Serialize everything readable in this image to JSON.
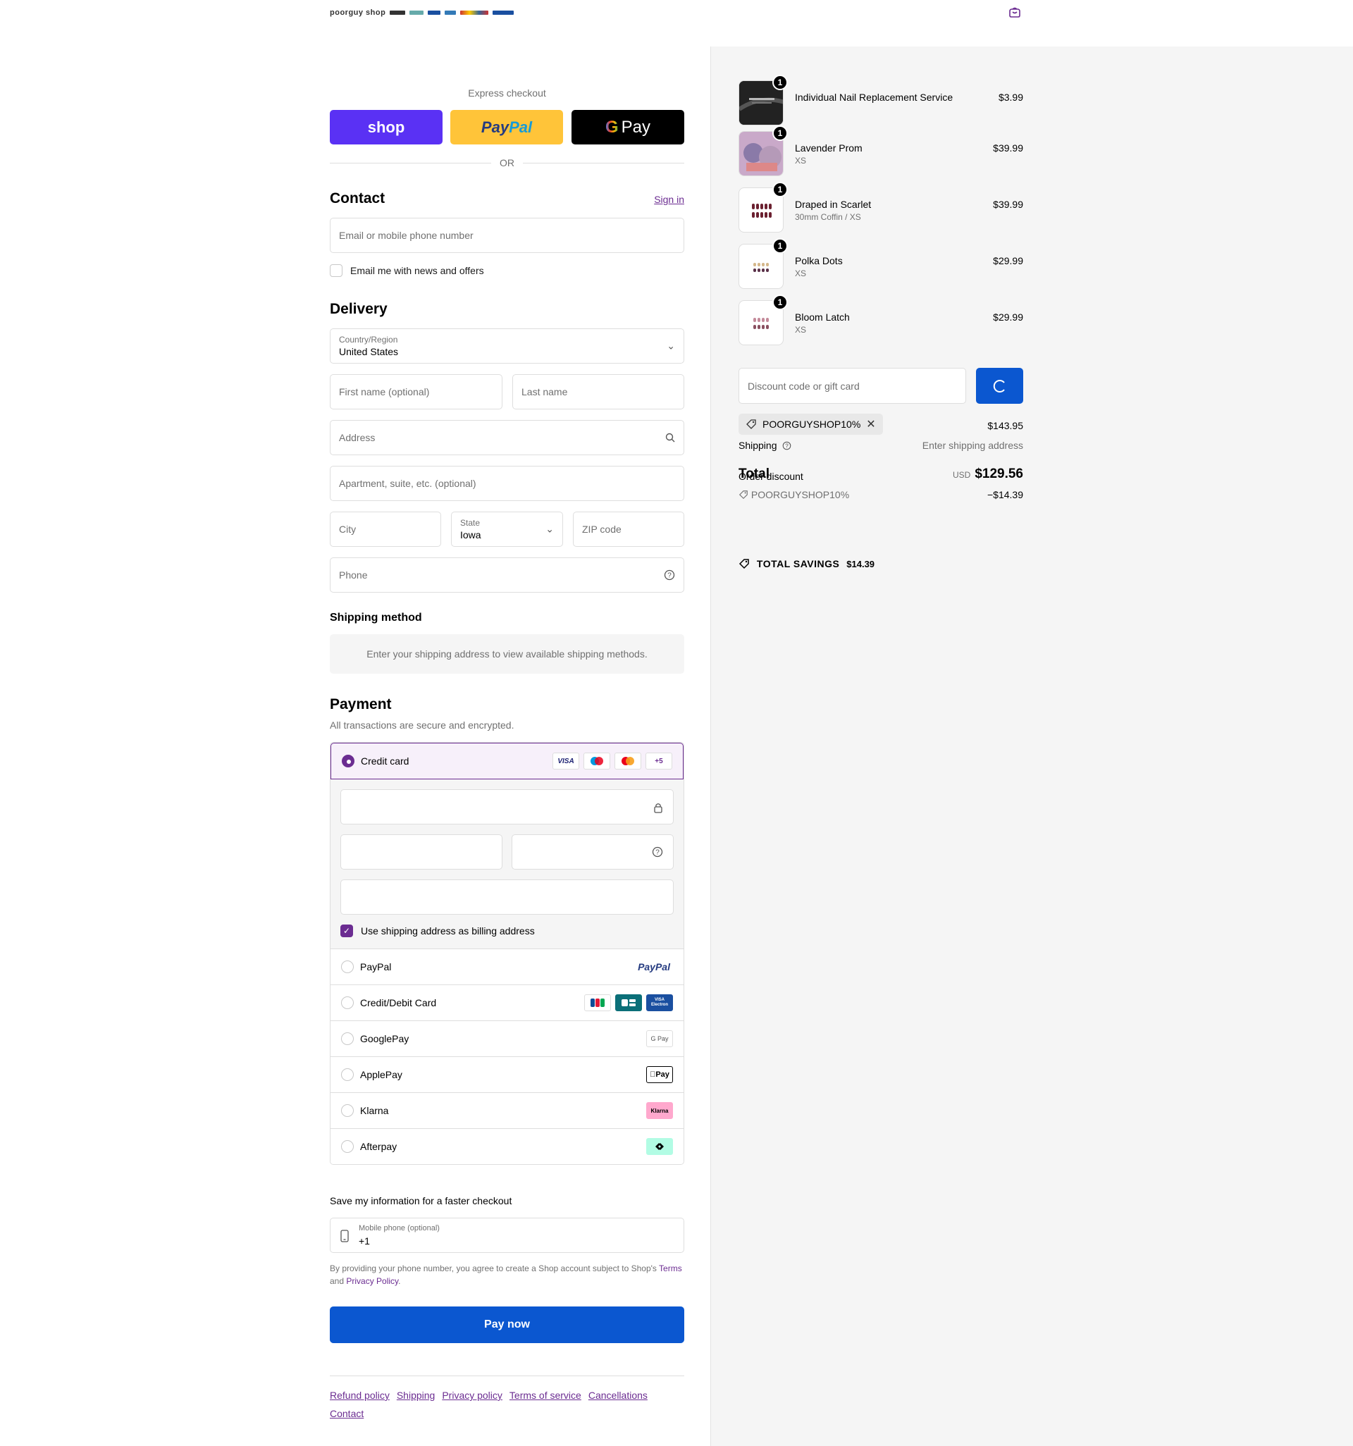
{
  "header": {
    "brand": "poorguy shop",
    "brand_payments": "Pay G Pay PayPal VISA"
  },
  "express": {
    "label": "Express checkout",
    "shop": "shop",
    "paypal_1": "Pay",
    "paypal_2": "Pal",
    "gpay_g": "G",
    "gpay": "Pay",
    "or": "OR"
  },
  "contact": {
    "title": "Contact",
    "signin": "Sign in",
    "email_placeholder": "Email or mobile phone number",
    "newsletter": "Email me with news and offers"
  },
  "delivery": {
    "title": "Delivery",
    "country_label": "Country/Region",
    "country": "United States",
    "first_name": "First name (optional)",
    "last_name": "Last name",
    "address": "Address",
    "apartment": "Apartment, suite, etc. (optional)",
    "city": "City",
    "state_label": "State",
    "state": "Iowa",
    "zip": "ZIP code",
    "phone": "Phone"
  },
  "shipping_method": {
    "title": "Shipping method",
    "message": "Enter your shipping address to view available shipping methods."
  },
  "payment": {
    "title": "Payment",
    "subtitle": "All transactions are secure and encrypted.",
    "credit_card": "Credit card",
    "card_visa": "VISA",
    "card_more": "+5",
    "billing_same": "Use shipping address as billing address",
    "options": [
      {
        "label": "PayPal",
        "logo": "PayPal"
      },
      {
        "label": "Credit/Debit Card",
        "logo": ""
      },
      {
        "label": "GooglePay",
        "logo": "G Pay"
      },
      {
        "label": "ApplePay",
        "logo": "Pay"
      },
      {
        "label": "Klarna",
        "logo": "Klarna"
      },
      {
        "label": "Afterpay",
        "logo": ""
      }
    ],
    "visa_electron": "VISA Electron"
  },
  "save_info": {
    "title": "Save my information for a faster checkout",
    "mobile_label": "Mobile phone (optional)",
    "mobile_value": "+1",
    "legal_1": "By providing your phone number, you agree to create a Shop account subject to Shop's",
    "terms": "Terms",
    "and": "and",
    "privacy": "Privacy Policy"
  },
  "pay_now": "Pay now",
  "footer_links": [
    "Refund policy",
    "Shipping",
    "Privacy policy",
    "Terms of service",
    "Cancellations",
    "Contact"
  ],
  "cart": {
    "items": [
      {
        "name": "Individual Nail Replacement Service",
        "variant": "",
        "price": "$3.99",
        "qty": "1"
      },
      {
        "name": "Lavender Prom",
        "variant": "XS",
        "price": "$39.99",
        "qty": "1"
      },
      {
        "name": "Draped in Scarlet",
        "variant": "30mm Coffin / XS",
        "price": "$39.99",
        "qty": "1"
      },
      {
        "name": "Polka Dots",
        "variant": "XS",
        "price": "$29.99",
        "qty": "1"
      },
      {
        "name": "Bloom Latch",
        "variant": "XS",
        "price": "$29.99",
        "qty": "1"
      }
    ],
    "discount_placeholder": "Discount code or gift card",
    "applied_code": "POORGUYSHOP10%",
    "subtotal_value": "$143.95",
    "shipping_label": "Shipping",
    "shipping_value": "Enter shipping address",
    "total_label": "Total",
    "order_discount_label": "Order discount",
    "currency": "USD",
    "total_value": "$129.56",
    "discount_code": "POORGUYSHOP10%",
    "discount_value": "−$14.39",
    "savings_label": "TOTAL SAVINGS",
    "savings_value": "$14.39"
  },
  "colors": {
    "accent": "#6b2c91",
    "primary": "#0b57d0",
    "shop": "#5a31f4",
    "paypal": "#ffc439"
  }
}
